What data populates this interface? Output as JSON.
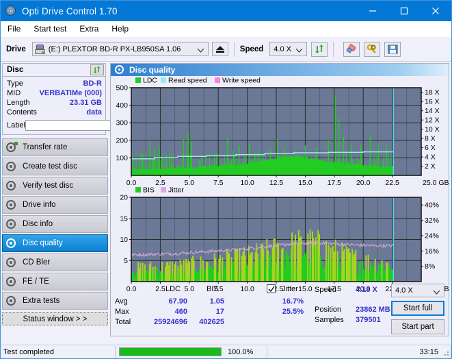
{
  "window": {
    "title": "Opti Drive Control 1.70",
    "icon": "disc-icon",
    "minimize": "minimize-icon",
    "maximize": "maximize-icon",
    "close": "close-icon"
  },
  "menu": {
    "items": [
      {
        "label": "File",
        "accel": "F"
      },
      {
        "label": "Start test",
        "accel": "S"
      },
      {
        "label": "Extra",
        "accel": "x"
      },
      {
        "label": "Help",
        "accel": "H"
      }
    ]
  },
  "toolbar": {
    "drive_label": "Drive",
    "drive_value": "(E:)   PLEXTOR BD-R  PX-LB950SA 1.06",
    "eject": "eject-icon",
    "speed_label": "Speed",
    "speed_value": "4.0 X",
    "refresh": "refresh-icon",
    "erase": "eraser-icon",
    "tools": "tools-icon",
    "save": "save-icon"
  },
  "disc": {
    "header": "Disc",
    "refresh_icon": "refresh-icon",
    "rows": [
      {
        "key": "Type",
        "value": "BD-R"
      },
      {
        "key": "MID",
        "value": "VERBATIMe (000)"
      },
      {
        "key": "Length",
        "value": "23.31 GB"
      },
      {
        "key": "Contents",
        "value": "data"
      }
    ],
    "label_key": "Label",
    "label_value": "",
    "label_placeholder": "",
    "cd_icon": "cd-icon"
  },
  "nav": {
    "items": [
      {
        "label": "Transfer rate",
        "selected": false
      },
      {
        "label": "Create test disc",
        "selected": false
      },
      {
        "label": "Verify test disc",
        "selected": false
      },
      {
        "label": "Drive info",
        "selected": false
      },
      {
        "label": "Disc info",
        "selected": false
      },
      {
        "label": "Disc quality",
        "selected": true
      },
      {
        "label": "CD Bler",
        "selected": false
      },
      {
        "label": "FE / TE",
        "selected": false
      },
      {
        "label": "Extra tests",
        "selected": false
      }
    ],
    "status_window": "Status window > >"
  },
  "panel": {
    "title": "Disc quality",
    "icon": "disc-quality-icon"
  },
  "stats": {
    "col_ldc": "LDC",
    "col_bis": "BIS",
    "jitter_label": "Jitter",
    "jitter_checked": true,
    "rows": [
      {
        "key": "Avg",
        "ldc": "67.90",
        "bis": "1.05",
        "jitter": "16.7%"
      },
      {
        "key": "Max",
        "ldc": "460",
        "bis": "17",
        "jitter": "25.5%"
      },
      {
        "key": "Total",
        "ldc": "25924696",
        "bis": "402625",
        "jitter": ""
      }
    ],
    "speed_key": "Speed",
    "speed_value": "4.18 X",
    "position_key": "Position",
    "position_value": "23862 MB",
    "samples_key": "Samples",
    "samples_value": "379501",
    "speed_select": "4.0 X",
    "start_full": "Start full",
    "start_part": "Start part"
  },
  "statusbar": {
    "message": "Test completed",
    "percent_text": "100.0%",
    "percent_value": 100,
    "time": "33:15"
  },
  "colors": {
    "accent": "#0478d7",
    "plot_bg": "#6b7996",
    "ldc": "#22cc22",
    "bis": "#22cc22",
    "bis_hi": "#a8d420",
    "read_speed": "#9fe8f2",
    "write_speed": "#ff7fe0",
    "jitter": "#d9a8dd",
    "cursor": "#4fd8ef",
    "value_text": "#3333cc",
    "progress": "#19bb19"
  },
  "chart_data": [
    {
      "type": "area",
      "name": "disc-quality-ldc",
      "title": "",
      "xlabel": "25.0 GB",
      "ylabel": "",
      "xlim": [
        0,
        25
      ],
      "ylim": [
        0,
        500
      ],
      "xticks": [
        "0.0",
        "2.5",
        "5.0",
        "7.5",
        "10.0",
        "12.5",
        "15.0",
        "17.5",
        "20.0",
        "22.5",
        "25.0"
      ],
      "yticks": [
        "100",
        "200",
        "300",
        "400",
        "500"
      ],
      "y2ticks": [
        "2 X",
        "4 X",
        "6 X",
        "8 X",
        "10 X",
        "12 X",
        "14 X",
        "16 X",
        "18 X"
      ],
      "y2lim": [
        0,
        19
      ],
      "grid": true,
      "legend": [
        "LDC",
        "Read speed",
        "Write speed"
      ],
      "legend_position": "top-left",
      "cursor_x": 22.6,
      "data_end_x": 22.6,
      "series": [
        {
          "name": "LDC",
          "color": "#22cc22",
          "baseline": [
            30,
            32,
            33,
            34,
            36,
            38,
            40,
            42,
            44,
            46,
            48,
            50,
            52,
            54,
            56,
            58,
            62,
            66,
            70,
            76,
            84,
            92,
            100,
            108,
            112,
            108,
            100,
            92,
            86,
            80,
            74,
            70,
            66,
            62,
            58,
            54,
            52,
            50,
            48,
            46
          ],
          "spikes": [
            {
              "x": 0.9,
              "y": 130
            },
            {
              "x": 1.6,
              "y": 195
            },
            {
              "x": 2.0,
              "y": 150
            },
            {
              "x": 2.4,
              "y": 170
            },
            {
              "x": 3.3,
              "y": 120
            },
            {
              "x": 4.5,
              "y": 205
            },
            {
              "x": 4.9,
              "y": 250
            },
            {
              "x": 5.2,
              "y": 195
            },
            {
              "x": 6.1,
              "y": 115
            },
            {
              "x": 7.4,
              "y": 130
            },
            {
              "x": 8.3,
              "y": 210
            },
            {
              "x": 8.8,
              "y": 140
            },
            {
              "x": 9.3,
              "y": 175
            },
            {
              "x": 10.2,
              "y": 180
            },
            {
              "x": 11.0,
              "y": 140
            },
            {
              "x": 12.0,
              "y": 150
            },
            {
              "x": 12.6,
              "y": 205
            },
            {
              "x": 13.2,
              "y": 165
            },
            {
              "x": 14.1,
              "y": 150
            },
            {
              "x": 15.0,
              "y": 170
            },
            {
              "x": 16.0,
              "y": 160
            },
            {
              "x": 17.0,
              "y": 200
            },
            {
              "x": 17.6,
              "y": 460
            },
            {
              "x": 17.9,
              "y": 330
            },
            {
              "x": 18.3,
              "y": 220
            },
            {
              "x": 19.0,
              "y": 190
            },
            {
              "x": 19.8,
              "y": 175
            },
            {
              "x": 20.6,
              "y": 230
            },
            {
              "x": 21.3,
              "y": 185
            },
            {
              "x": 22.0,
              "y": 165
            }
          ]
        },
        {
          "name": "Read speed",
          "color": "#9fe8f2",
          "steps": [
            {
              "x": 0.0,
              "y": 3.6
            },
            {
              "x": 2.0,
              "y": 3.9
            },
            {
              "x": 4.0,
              "y": 4.1
            },
            {
              "x": 6.5,
              "y": 4.3
            },
            {
              "x": 9.0,
              "y": 4.5
            },
            {
              "x": 11.5,
              "y": 4.7
            },
            {
              "x": 14.0,
              "y": 4.9
            },
            {
              "x": 17.0,
              "y": 5.0
            },
            {
              "x": 20.0,
              "y": 5.1
            },
            {
              "x": 22.6,
              "y": 5.2
            }
          ]
        }
      ]
    },
    {
      "type": "bar",
      "name": "disc-quality-bis-jitter",
      "title": "",
      "xlabel": "25.0 GB",
      "ylabel": "",
      "xlim": [
        0,
        25
      ],
      "ylim": [
        0,
        20
      ],
      "xticks": [
        "0.0",
        "2.5",
        "5.0",
        "7.5",
        "10.0",
        "12.5",
        "15.0",
        "17.5",
        "20.0",
        "22.5",
        "25.0"
      ],
      "yticks": [
        "5",
        "10",
        "15",
        "20"
      ],
      "y2ticks": [
        "8%",
        "16%",
        "24%",
        "32%",
        "40%"
      ],
      "y2lim": [
        0,
        44
      ],
      "grid": true,
      "legend": [
        "BIS",
        "Jitter"
      ],
      "legend_position": "top-left",
      "cursor_x": 22.6,
      "data_end_x": 22.6,
      "series": [
        {
          "name": "BIS",
          "color": "#22cc22",
          "color_high": "#a8d420",
          "envelope": [
            3.2,
            3.3,
            3.4,
            3.5,
            3.6,
            3.7,
            3.8,
            3.9,
            4.0,
            4.2,
            4.4,
            4.6,
            4.8,
            5.0,
            5.2,
            5.4,
            5.6,
            5.9,
            6.2,
            6.6,
            7.0,
            7.4,
            7.8,
            8.2,
            8.6,
            8.9,
            9.1,
            9.0,
            8.6,
            8.0,
            7.4,
            6.8,
            6.2,
            5.8,
            5.4,
            5.1,
            4.9,
            4.7,
            4.6,
            4.5
          ]
        },
        {
          "name": "Jitter",
          "color": "#d9a8dd",
          "trace": [
            6.3,
            6.4,
            6.4,
            6.5,
            6.5,
            6.6,
            6.6,
            6.7,
            6.8,
            6.9,
            7.0,
            7.1,
            7.2,
            7.3,
            7.4,
            7.5,
            7.6,
            7.8,
            7.9,
            8.1,
            8.3,
            8.5,
            8.6,
            8.8,
            8.9,
            9.0,
            9.1,
            9.2,
            9.2,
            9.1,
            9.0,
            8.9,
            8.8,
            8.7,
            8.6,
            8.6,
            8.5,
            8.5,
            8.5,
            8.5
          ]
        }
      ]
    }
  ]
}
